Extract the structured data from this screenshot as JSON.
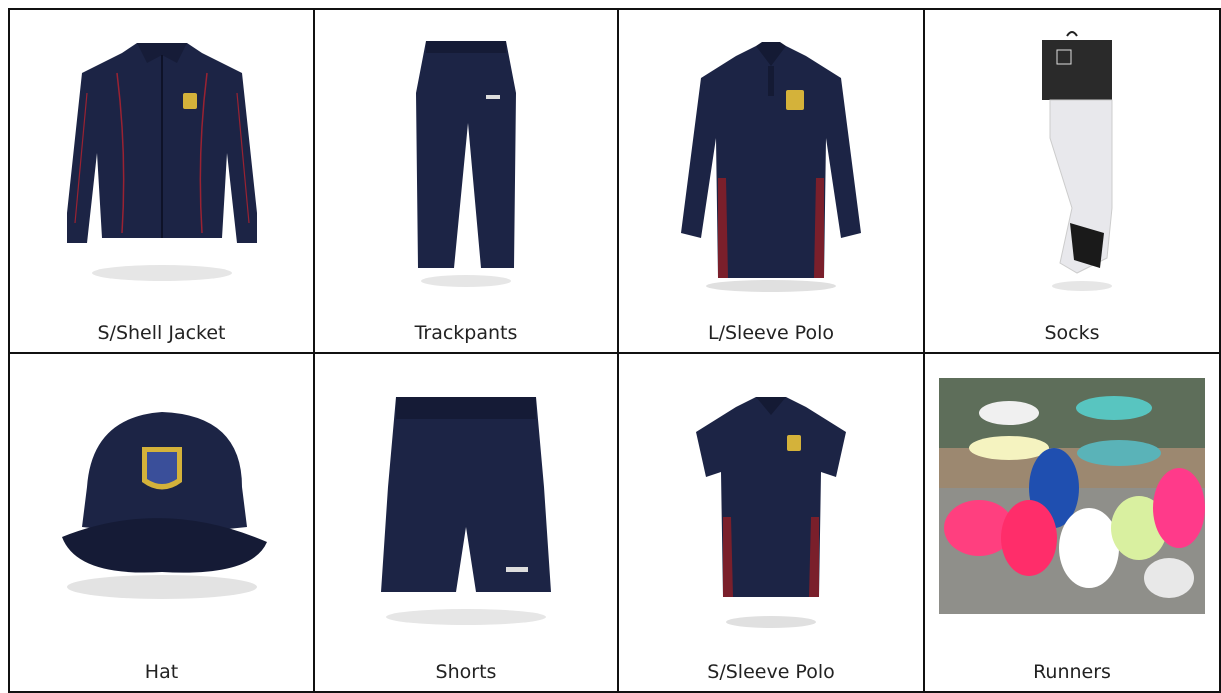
{
  "items": [
    {
      "label": "S/Shell Jacket",
      "icon": "jacket-icon"
    },
    {
      "label": "Trackpants",
      "icon": "trackpants-icon"
    },
    {
      "label": "L/Sleeve Polo",
      "icon": "long-sleeve-polo-icon"
    },
    {
      "label": "Socks",
      "icon": "socks-icon"
    },
    {
      "label": "Hat",
      "icon": "cap-icon"
    },
    {
      "label": "Shorts",
      "icon": "shorts-icon"
    },
    {
      "label": "S/Sleeve Polo",
      "icon": "short-sleeve-polo-icon"
    },
    {
      "label": "Runners",
      "icon": "runners-photo"
    }
  ],
  "colors": {
    "navy": "#1c2445",
    "maroon": "#7a1f2b",
    "border": "#111111"
  }
}
